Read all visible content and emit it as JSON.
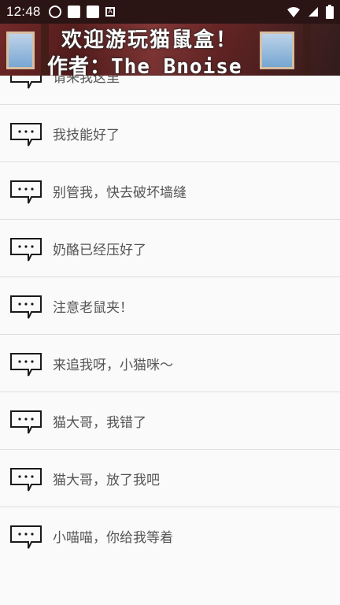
{
  "status_bar": {
    "time": "12:48",
    "icons_left": [
      "nav-icon",
      "box-icon",
      "box-icon",
      "a-icon"
    ],
    "icons_right": [
      "wifi-icon",
      "signal-icon",
      "battery-icon"
    ]
  },
  "banner": {
    "title": "欢迎游玩猫鼠盒！",
    "author": "作者：The_Bnoise"
  },
  "list": {
    "items": [
      {
        "label": "请来我这里",
        "icon": "speech-bubble-icon"
      },
      {
        "label": "我技能好了",
        "icon": "speech-bubble-icon"
      },
      {
        "label": "别管我，快去破坏墙缝",
        "icon": "speech-bubble-icon"
      },
      {
        "label": "奶酪已经压好了",
        "icon": "speech-bubble-icon"
      },
      {
        "label": "注意老鼠夹！",
        "icon": "speech-bubble-icon"
      },
      {
        "label": "来追我呀，小猫咪～",
        "icon": "speech-bubble-icon"
      },
      {
        "label": "猫大哥，我错了",
        "icon": "speech-bubble-icon"
      },
      {
        "label": "猫大哥，放了我吧",
        "icon": "speech-bubble-icon"
      },
      {
        "label": "小喵喵，你给我等着",
        "icon": "speech-bubble-icon"
      }
    ]
  },
  "colors": {
    "status_bar_bg": "#2b1414",
    "list_bg": "#fafafa",
    "divider": "#dedede",
    "text": "#555555",
    "icon": "#1a1a1a"
  }
}
